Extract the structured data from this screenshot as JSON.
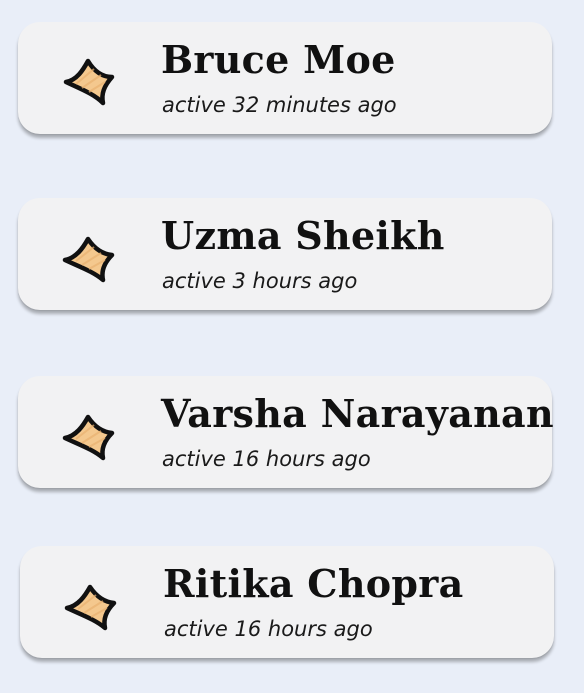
{
  "users": [
    {
      "name": "Bruce Moe",
      "status": "active 32 minutes ago",
      "avatar_icon": "star-sketch-icon"
    },
    {
      "name": "Uzma Sheikh",
      "status": "active 3 hours ago",
      "avatar_icon": "star-sketch-icon"
    },
    {
      "name": "Varsha Narayanan",
      "status": "active 16 hours ago",
      "avatar_icon": "star-sketch-icon"
    },
    {
      "name": "Ritika Chopra",
      "status": "active 16 hours ago",
      "avatar_icon": "star-sketch-icon"
    }
  ],
  "colors": {
    "background": "#e9eef8",
    "card": "#f2f2f3",
    "icon_fill": "#f4c88e",
    "icon_stroke": "#111111"
  }
}
